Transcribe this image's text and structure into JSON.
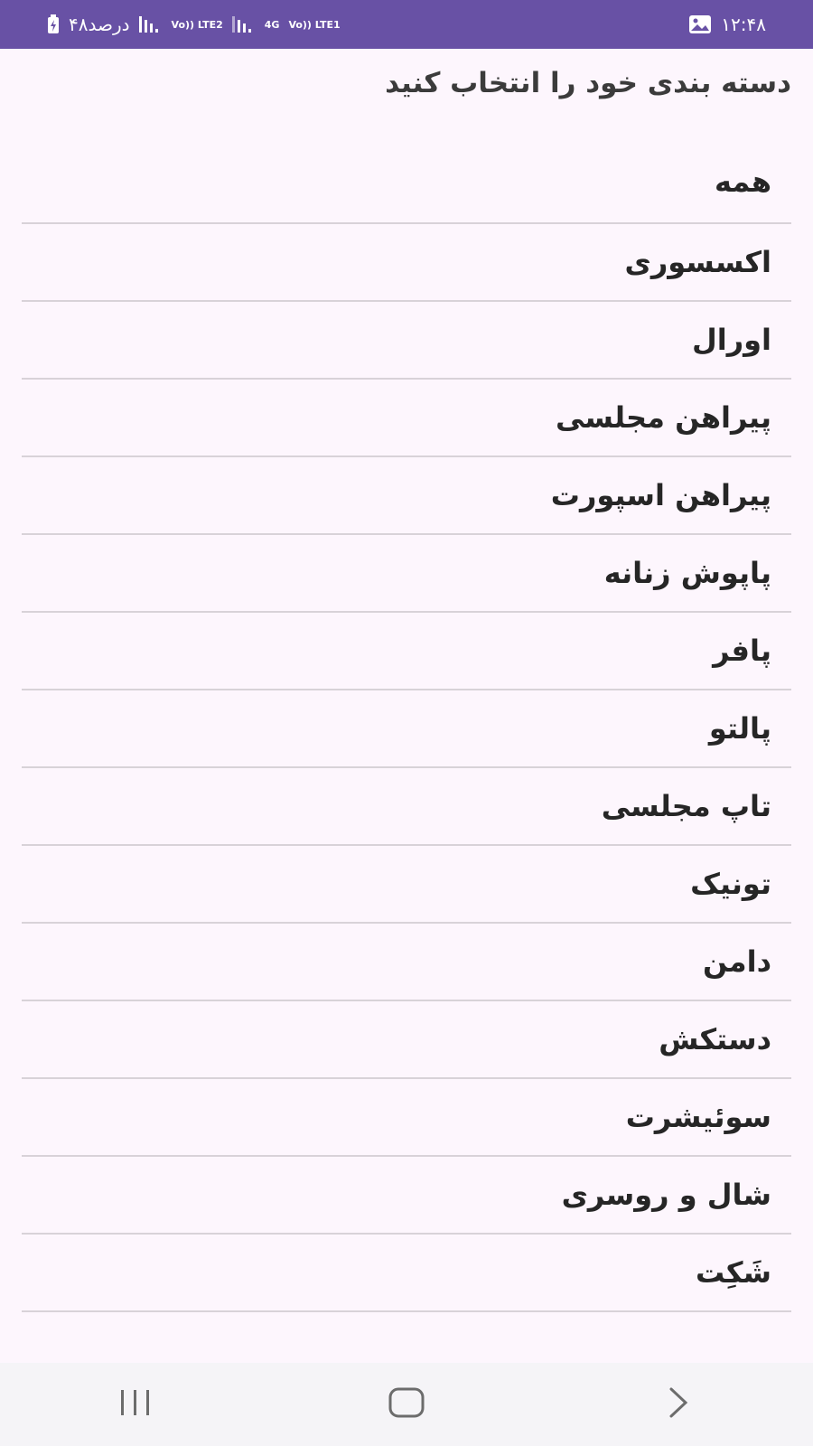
{
  "status_bar": {
    "time": "۱۲:۴۸",
    "battery_text": "۴۸درصد",
    "network_labels": [
      "Vo)) LTE2",
      "4G",
      "Vo)) LTE1"
    ],
    "background_color": "#6851a5",
    "icons": [
      "gallery-icon",
      "battery-icon",
      "signal-icon",
      "signal-icon",
      "data-transfer-icon"
    ]
  },
  "page": {
    "title": "دسته بندی خود را انتخاب کنید"
  },
  "categories": [
    "همه",
    "اکسسوری",
    "اورال",
    "پیراهن مجلسی",
    "پیراهن اسپورت",
    "پاپوش زنانه",
    "پافر",
    "پالتو",
    "تاپ مجلسی",
    "تونیک",
    "دامن",
    "دستکش",
    "سوئیشرت",
    "شال و روسری",
    "شَکِت"
  ],
  "nav_bar": {
    "buttons": [
      "recents-icon",
      "home-icon",
      "back-icon"
    ]
  }
}
